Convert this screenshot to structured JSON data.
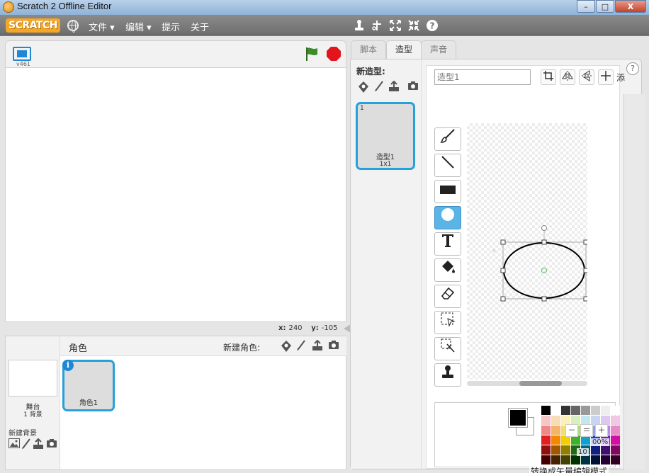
{
  "window": {
    "title": "Scratch 2 Offline Editor",
    "minimize": "–",
    "maximize": "□",
    "close": "X"
  },
  "menubar": {
    "logo": "SCRATCH",
    "items": [
      "文件 ▾",
      "编辑 ▾",
      "提示",
      "关于"
    ]
  },
  "toolbar_icons": [
    "duplicate-stamp-icon",
    "cut-scissors-icon",
    "grow-icon",
    "shrink-icon",
    "help-icon"
  ],
  "stage": {
    "version": "v461",
    "coords": {
      "x_label": "x:",
      "x_value": "240",
      "y_label": "y:",
      "y_value": "-105"
    }
  },
  "sprites": {
    "title": "角色",
    "new_sprite_label": "新建角色:",
    "stage_name": "舞台",
    "stage_backdrops": "1 背景",
    "new_backdrop_label": "新建背景",
    "items": [
      {
        "name": "角色1"
      }
    ]
  },
  "tabs": [
    "脚本",
    "造型",
    "声音"
  ],
  "active_tab": "造型",
  "costumes": {
    "new_costume_label": "新造型:",
    "items": [
      {
        "number": "1",
        "name": "造型1",
        "size": "1x1"
      }
    ]
  },
  "editor": {
    "costume_name_placeholder": "造型1",
    "add_label": "添",
    "tools": [
      "brush",
      "line",
      "rectangle",
      "ellipse",
      "text",
      "fill",
      "eraser",
      "select",
      "reshape-select",
      "stamp"
    ],
    "active_tool": "ellipse",
    "zoom_label": "00%",
    "zoom_partial": "10",
    "convert_label": "转换成矢量编辑模式"
  },
  "colors": {
    "accent": "#26a0da",
    "selected_tool": "#5ab5e6",
    "stop": "#e2151c",
    "flag": "#3c8c2c",
    "primary_swatch": "#000000",
    "secondary_swatch": "#ffffff"
  }
}
